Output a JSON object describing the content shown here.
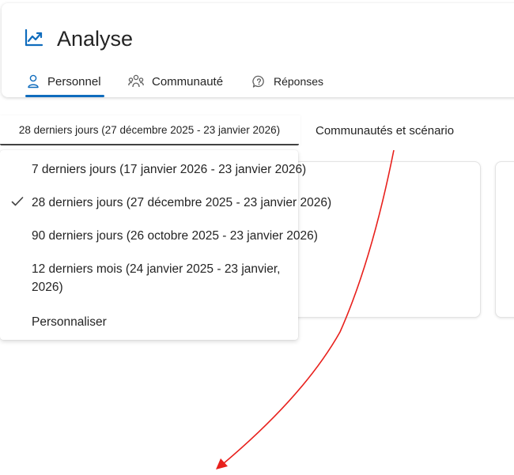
{
  "header": {
    "title": "Analyse",
    "title_icon": "trending-up-icon",
    "tabs": [
      {
        "label": "Personnel",
        "icon": "person-icon",
        "active": true
      },
      {
        "label": "Communauté",
        "icon": "people-community-icon",
        "active": false
      },
      {
        "label": "Réponses",
        "icon": "chat-question-icon",
        "active": false
      }
    ]
  },
  "filters": {
    "date_range_selected": "28 derniers jours (27 décembre 2025 - 23 janvier 2026)",
    "community_tab": "Communautés et scénario"
  },
  "dropdown": {
    "options": [
      {
        "label": "7 derniers jours (17 janvier 2026 - 23 janvier 2026)",
        "selected": false
      },
      {
        "label": "28 derniers jours (27 décembre 2025 - 23 janvier 2026)",
        "selected": true
      },
      {
        "label": "90 derniers jours (26 octobre 2025 - 23 janvier 2026)",
        "selected": false
      },
      {
        "label": "12 derniers mois (24 janvier 2025 - 23 janvier, 2026)",
        "selected": false
      },
      {
        "label": "Personnaliser",
        "selected": false
      }
    ]
  },
  "colors": {
    "accent": "#0f6cbd",
    "annotation_arrow": "#e8201c",
    "text": "#242424"
  }
}
